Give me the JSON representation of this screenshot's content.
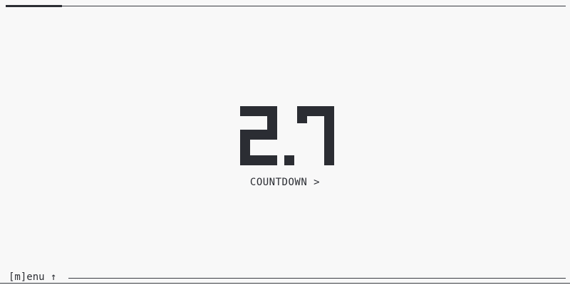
{
  "timer": {
    "display": "2.7",
    "progress_fraction": 0.1
  },
  "mode": {
    "label": "COUNTDOWN >"
  },
  "footer": {
    "menu_label": "[m]enu ↑"
  },
  "colors": {
    "background": "#f8f8f8",
    "foreground": "#2b2d33"
  }
}
